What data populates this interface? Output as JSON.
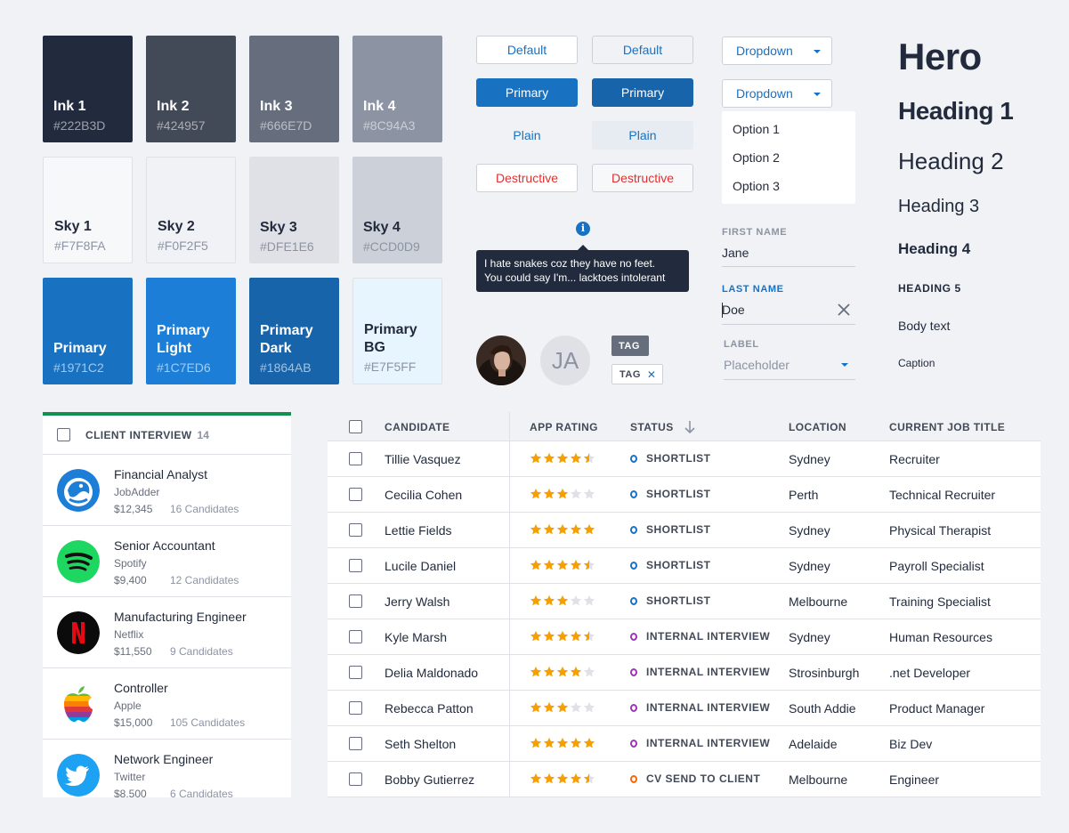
{
  "swatches": [
    {
      "name": "Ink 1",
      "hex": "#222B3D",
      "color": "#222B3D"
    },
    {
      "name": "Ink 2",
      "hex": "#424957",
      "color": "#424957"
    },
    {
      "name": "Ink 3",
      "hex": "#666E7D",
      "color": "#666E7D"
    },
    {
      "name": "Ink 4",
      "hex": "#8C94A3",
      "color": "#8C94A3"
    },
    {
      "name": "Sky 1",
      "hex": "#F7F8FA",
      "color": "#F7F8FA"
    },
    {
      "name": "Sky 2",
      "hex": "#F0F2F5",
      "color": "#F0F2F5"
    },
    {
      "name": "Sky 3",
      "hex": "#DFE1E6",
      "color": "#DFE1E6"
    },
    {
      "name": "Sky 4",
      "hex": "#CCD0D9",
      "color": "#CCD0D9"
    },
    {
      "name": "Primary",
      "hex": "#1971C2",
      "color": "#1971C2"
    },
    {
      "name": "Primary Light",
      "hex": "#1C7ED6",
      "color": "#1C7ED6"
    },
    {
      "name": "Primary Dark",
      "hex": "#1864AB",
      "color": "#1864AB"
    },
    {
      "name": "Primary BG",
      "hex": "#E7F5FF",
      "color": "#E7F5FF"
    }
  ],
  "buttons": {
    "default": "Default",
    "primary": "Primary",
    "plain": "Plain",
    "destructive": "Destructive"
  },
  "tooltip": {
    "icon": "info-icon",
    "text_line1": "I hate snakes coz they have no feet.",
    "text_line2": "You could say I'm... lacktoes intolerant"
  },
  "avatar": {
    "initials": "JA"
  },
  "tags": {
    "label": "TAG",
    "label_removable": "TAG"
  },
  "dropdowns": {
    "label": "Dropdown",
    "options": [
      "Option 1",
      "Option 2",
      "Option 3"
    ]
  },
  "form": {
    "first_name_label": "FIRST NAME",
    "first_name_value": "Jane",
    "last_name_label": "LAST NAME",
    "last_name_value": "Doe",
    "select_label": "LABEL",
    "select_placeholder": "Placeholder"
  },
  "typography": {
    "hero": "Hero",
    "h1": "Heading 1",
    "h2": "Heading 2",
    "h3": "Heading 3",
    "h4": "Heading 4",
    "h5": "HEADING 5",
    "body": "Body text",
    "caption": "Caption"
  },
  "joblist": {
    "title": "CLIENT INTERVIEW",
    "count": "14",
    "accent_color": "#12904F",
    "jobs": [
      {
        "title": "Financial Analyst",
        "company": "JobAdder",
        "salary": "$12,345",
        "candidates": "16 Candidates",
        "logo": "jobadder-logo"
      },
      {
        "title": "Senior Accountant",
        "company": "Spotify",
        "salary": "$9,400",
        "candidates": "12 Candidates",
        "logo": "spotify-logo"
      },
      {
        "title": "Manufacturing Engineer",
        "company": "Netflix",
        "salary": "$11,550",
        "candidates": "9 Candidates",
        "logo": "netflix-logo"
      },
      {
        "title": "Controller",
        "company": "Apple",
        "salary": "$15,000",
        "candidates": "105 Candidates",
        "logo": "apple-logo"
      },
      {
        "title": "Network Engineer",
        "company": "Twitter",
        "salary": "$8,500",
        "candidates": "6 Candidates",
        "logo": "twitter-logo"
      }
    ]
  },
  "table": {
    "headers": {
      "candidate": "CANDIDATE",
      "rating": "APP RATING",
      "status": "STATUS",
      "location": "LOCATION",
      "job_title": "CURRENT JOB TITLE"
    },
    "sort_icon": "arrow-down-icon",
    "status_colors": {
      "SHORTLIST": "#1971C2",
      "INTERNAL INTERVIEW": "#9C36B5",
      "CV SEND TO CLIENT": "#F76707"
    },
    "star_color": "#F59F00",
    "rows": [
      {
        "name": "Tillie Vasquez",
        "rating": 4.5,
        "status": "SHORTLIST",
        "location": "Sydney",
        "job": "Recruiter"
      },
      {
        "name": "Cecilia Cohen",
        "rating": 3,
        "status": "SHORTLIST",
        "location": "Perth",
        "job": "Technical Recruiter"
      },
      {
        "name": "Lettie Fields",
        "rating": 5,
        "status": "SHORTLIST",
        "location": "Sydney",
        "job": "Physical Therapist"
      },
      {
        "name": "Lucile Daniel",
        "rating": 4.5,
        "status": "SHORTLIST",
        "location": "Sydney",
        "job": "Payroll Specialist"
      },
      {
        "name": "Jerry Walsh",
        "rating": 3,
        "status": "SHORTLIST",
        "location": "Melbourne",
        "job": "Training Specialist"
      },
      {
        "name": "Kyle Marsh",
        "rating": 4.5,
        "status": "INTERNAL INTERVIEW",
        "location": "Sydney",
        "job": "Human Resources"
      },
      {
        "name": "Delia Maldonado",
        "rating": 4,
        "status": "INTERNAL INTERVIEW",
        "location": "Strosinburgh",
        "job": ".net Developer"
      },
      {
        "name": "Rebecca Patton",
        "rating": 3,
        "status": "INTERNAL INTERVIEW",
        "location": "South Addie",
        "job": "Product Manager"
      },
      {
        "name": "Seth Shelton",
        "rating": 5,
        "status": "INTERNAL INTERVIEW",
        "location": "Adelaide",
        "job": "Biz Dev"
      },
      {
        "name": "Bobby Gutierrez",
        "rating": 4.5,
        "status": "CV SEND TO CLIENT",
        "location": "Melbourne",
        "job": "Engineer"
      }
    ]
  }
}
